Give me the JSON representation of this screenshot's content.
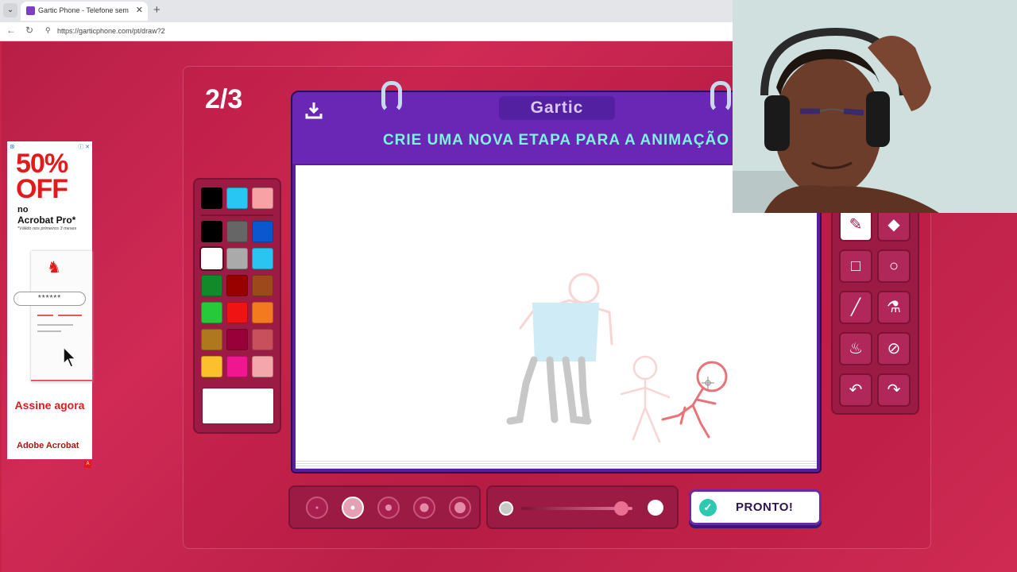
{
  "browser": {
    "tab_title": "Gartic Phone - Telefone sem fio",
    "url": "https://garticphone.com/pt/draw?2",
    "close_glyph": "✕",
    "new_tab_glyph": "+",
    "menu_glyph": "⌄"
  },
  "game": {
    "round": "2/3",
    "logo": "Gartic",
    "instruction": "CRIE UMA NOVA ETAPA PARA A ANIMAÇÃO",
    "done_button": "PRONTO!"
  },
  "palette": {
    "colors": [
      "#000000",
      "#28c6f2",
      "#f7a3a6",
      "#000000",
      "#666666",
      "#0b57d0",
      "#ffffff",
      "#aaaaaa",
      "#29c4f0",
      "#128a2a",
      "#990000",
      "#9c4a1b",
      "#26c93a",
      "#ef1313",
      "#f47a22",
      "#b0781e",
      "#99003a",
      "#c84f5c",
      "#fdc02d",
      "#f0168f",
      "#f4a7ab"
    ],
    "selected": "#ffffff"
  },
  "tools": [
    "pencil-icon",
    "eraser-icon",
    "rectangle-icon",
    "ellipse-icon",
    "line-icon",
    "eyedropper-icon",
    "fill-icon",
    "clear-icon",
    "undo-icon",
    "redo-icon"
  ],
  "brush": {
    "selected_size_index": 1,
    "opacity": 0.9
  },
  "ad": {
    "headline": "50% OFF",
    "line1": "no",
    "line2": "Acrobat Pro*",
    "disclaimer": "*Válido nos primeiros 3 meses",
    "password": "******",
    "cta": "Assine agora",
    "brand": "Adobe Acrobat"
  }
}
